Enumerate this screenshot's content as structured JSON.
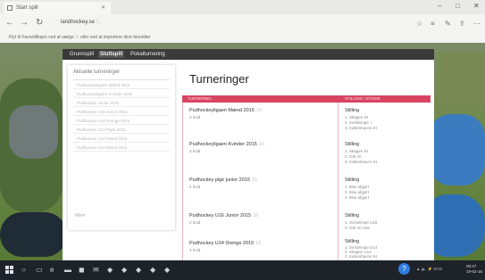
{
  "browser": {
    "tab_title": "Start spill",
    "address_host": "landhockey.se",
    "address_rest": "/...",
    "favorites_bar_text": "Flyt til Favorittlinjen ved at vælge ☆ eller ved at importere dine favoritter"
  },
  "site": {
    "nav": [
      "Grunnspill",
      "Sluttspill",
      "Pokalturnering"
    ],
    "active_nav_index": 1,
    "sidebar": {
      "title": "Aktuelle turneringer",
      "items": [
        "Pudhockeyligaen Mænd 2015",
        "Pudhockeyligaen Kvinder 2015",
        "Pudhockey Junior 2015",
        "Pudhockey U16 Junior 2015",
        "Pudhockey U14 Drenge 2015",
        "Pudhockey U14 Piger 2015",
        "Pudhockey U12 Mixed 2015",
        "Pudhockey U10 Mixed 2015"
      ],
      "more_label": "Mere"
    },
    "page_title": "Turneringer",
    "table_headers": {
      "left": "TURNERING",
      "right": "STILLING / STADIE"
    },
    "tournaments": [
      {
        "name": "Pudhockeyligaen Mænd 2015",
        "badge": "16",
        "count": "3 hold",
        "standing_label": "Stilling",
        "standings": [
          "Skagen IH",
          "Svrkæmpe +",
          "Københavns IH"
        ]
      },
      {
        "name": "Pudhockeyligaen Kvinder 2015",
        "badge": "15",
        "count": "3 hold",
        "standing_label": "Stilling",
        "standings": [
          "Skagen IH",
          "Odr Gi",
          "Københavns IH"
        ]
      },
      {
        "name": "Pudhockey pige junior 2015",
        "badge": "15",
        "count": "4 hold",
        "standing_label": "Stilling",
        "standings": [
          "Ikke afgjort",
          "Ikke afgjort",
          "Ikke afgjort"
        ]
      },
      {
        "name": "Pudhockey U16 Junior 2015",
        "badge": "16",
        "count": "2 hold",
        "standing_label": "Stilling",
        "standings": [
          "Svrkæmpe U16",
          "Odr Gi U16"
        ]
      },
      {
        "name": "Pudhockey U14 Drenge 2015",
        "badge": "16",
        "count": "3 hold",
        "standing_label": "Stilling",
        "standings": [
          "Svrkæmpe U14",
          "Skagen U14",
          "Københavns IH"
        ]
      }
    ]
  },
  "taskbar": {
    "tray": "▲ 🔈 ⚡ DAN",
    "time": "09:47",
    "date": "19-02-15"
  }
}
